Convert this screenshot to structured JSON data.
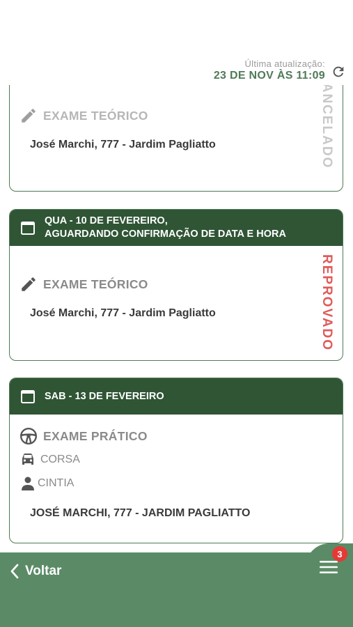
{
  "last_update": {
    "label": "Última atualização:",
    "value": "23 DE NOV ÀS 11:09"
  },
  "cards": [
    {
      "header": "",
      "exam_title": "EXAME TEÓRICO",
      "address": "José Marchi, 777 - Jardim Pagliatto",
      "status": "CANCELADO",
      "status_color": "#c8c8c8",
      "icon": "pencil-icon"
    },
    {
      "header_line1": "QUA - 10 DE FEVEREIRO,",
      "header_line2": "AGUARDANDO CONFIRMAÇÃO DE DATA E HORA",
      "exam_title": "EXAME TEÓRICO",
      "address": "José Marchi, 777 - Jardim Pagliatto",
      "status": "REPROVADO",
      "status_color": "#e05a5a",
      "icon": "pencil-icon"
    },
    {
      "header_line1": "SAB - 13 DE FEVEREIRO",
      "exam_title": "EXAME PRÁTICO",
      "vehicle": "CORSA",
      "instructor": "CINTIA",
      "address": "JOSÉ MARCHI, 777 - JARDIM PAGLIATTO",
      "icon": "steering-wheel-icon"
    }
  ],
  "bottom_bar": {
    "back_label": "Voltar",
    "badge_count": "3"
  },
  "colors": {
    "header_green": "#2f5535",
    "bar_green": "#5b8b66",
    "accent_green": "#4f7a58",
    "reprovado": "#e05a5a",
    "badge": "#e53935"
  }
}
